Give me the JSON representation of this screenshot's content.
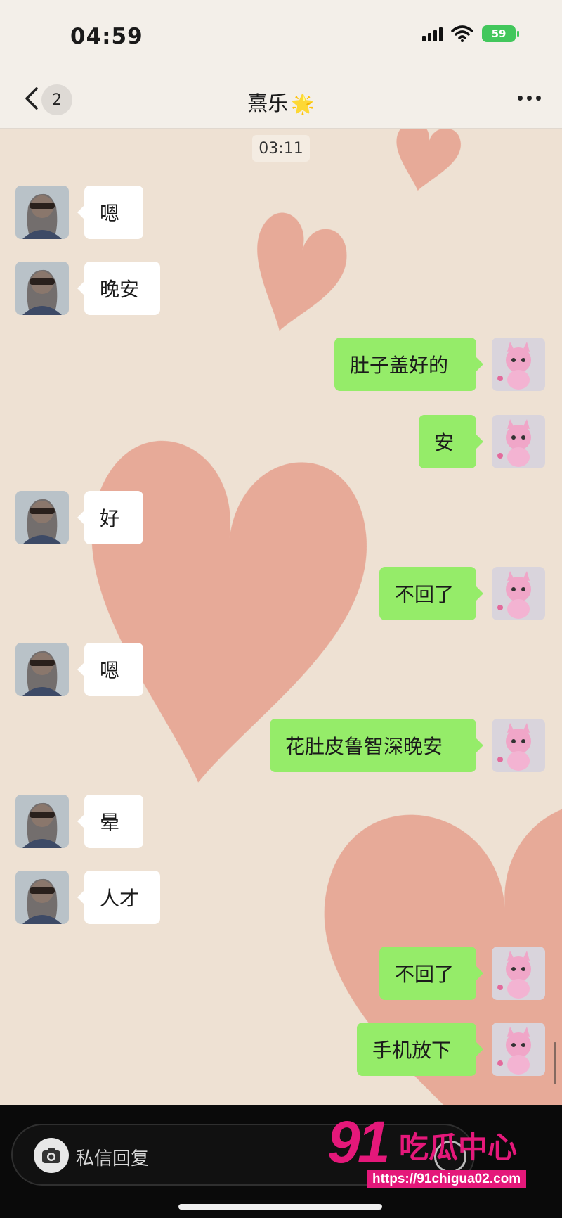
{
  "status": {
    "time": "04:59",
    "battery": "59"
  },
  "nav": {
    "unread_count": "2",
    "title": "熹乐",
    "title_emoji": "🌟"
  },
  "timestamp": "03:11",
  "messages": [
    {
      "side": "in",
      "text": "嗯"
    },
    {
      "side": "in",
      "text": "晚安"
    },
    {
      "side": "out",
      "text": "肚子盖好的"
    },
    {
      "side": "out",
      "text": "安"
    },
    {
      "side": "in",
      "text": "好"
    },
    {
      "side": "out",
      "text": "不回了"
    },
    {
      "side": "in",
      "text": "嗯"
    },
    {
      "side": "out",
      "text": "花肚皮鲁智深晚安"
    },
    {
      "side": "in",
      "text": "晕"
    },
    {
      "side": "in",
      "text": "人才"
    },
    {
      "side": "out",
      "text": "不回了"
    },
    {
      "side": "out",
      "text": "手机放下"
    }
  ],
  "input": {
    "placeholder": "私信回复"
  },
  "watermark": {
    "number": "91",
    "text": "吃瓜中心",
    "url": "https://91chigua02.com"
  },
  "colors": {
    "bubble_out": "#95ec69",
    "bubble_in": "#ffffff",
    "heart": "#e6a08e",
    "watermark": "#e4187a"
  },
  "icons": [
    "back-chevron-icon",
    "more-dots-icon",
    "camera-icon",
    "emoji-icon",
    "signal-icon",
    "wifi-icon",
    "battery-icon"
  ]
}
